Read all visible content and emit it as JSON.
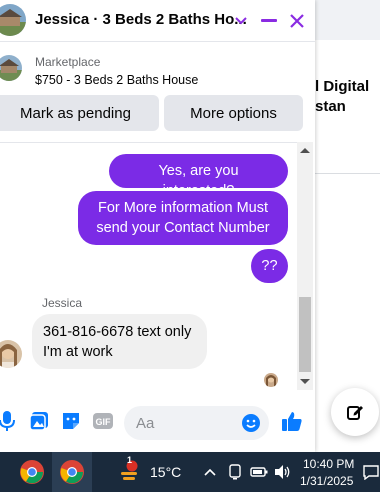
{
  "chat": {
    "title": "Jessica · 3 Beds 2 Baths Ho...",
    "listing_source": "Marketplace",
    "listing_title": "$750 - 3 Beds 2 Baths House",
    "mark_pending_label": "Mark as pending",
    "more_options_label": "More options"
  },
  "messages": {
    "outgoing": [
      "Yes, are you interested?",
      "For More information Must send your Contact Number",
      "??"
    ],
    "sender_name": "Jessica",
    "incoming": "361-816-6678 text only I'm at work"
  },
  "composer": {
    "placeholder": "Aa"
  },
  "background": {
    "line1": "l Digital",
    "line2": "stan"
  },
  "taskbar": {
    "temperature": "15°C",
    "time": "10:40 PM",
    "date": "1/31/2025",
    "weather_badge": "1"
  },
  "colors": {
    "accent": "#7b2be6",
    "messenger_blue": "#0a7cff",
    "taskbar": "#1a2a3c"
  },
  "icons": {
    "header": [
      "chevron-down-icon",
      "minimize-icon",
      "close-icon"
    ],
    "composer": [
      "microphone-icon",
      "photo-icon",
      "sticker-icon",
      "gif-icon",
      "emoji-icon",
      "thumbs-up-icon"
    ]
  }
}
